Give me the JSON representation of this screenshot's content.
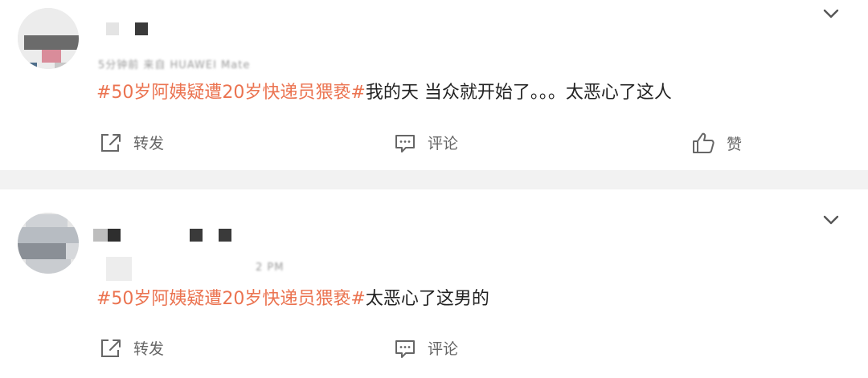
{
  "feed": {
    "posts": [
      {
        "username": "",
        "meta": "5分钟前 来自 HUAWEI Mate",
        "hashtag": "#50岁阿姨疑遭20岁快递员猥亵#",
        "text": "我的天 当众就开始了。。。太恶心了这人",
        "actions": {
          "forward": "转发",
          "comment": "评论",
          "like": "赞"
        }
      },
      {
        "username": "",
        "meta": "2 PM",
        "hashtag": "#50岁阿姨疑遭20岁快递员猥亵#",
        "text": "太恶心了这男的",
        "actions": {
          "forward": "转发",
          "comment": "评论"
        }
      }
    ]
  },
  "colors": {
    "hashtag": "#eb7350",
    "text": "#222222",
    "action": "#666666",
    "separator": "#f2f2f2"
  },
  "icons": [
    "chevron-down-icon",
    "forward-icon",
    "comment-icon",
    "like-icon"
  ]
}
